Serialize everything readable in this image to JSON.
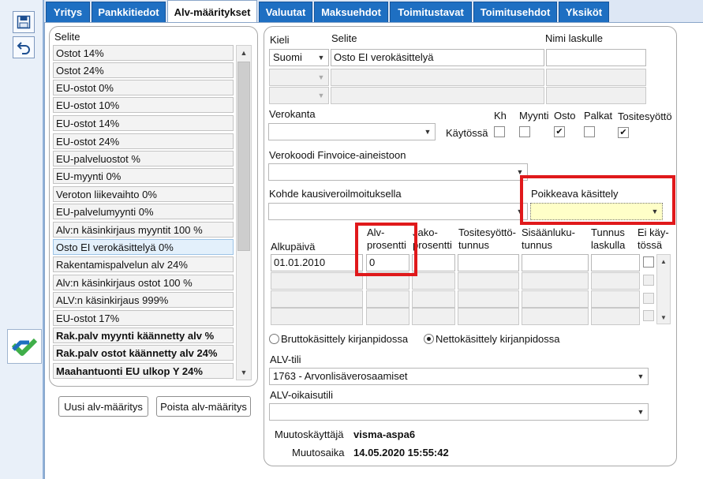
{
  "tabs": [
    {
      "label": "Yritys"
    },
    {
      "label": "Pankkitiedot"
    },
    {
      "label": "Alv-määritykset"
    },
    {
      "label": "Valuutat"
    },
    {
      "label": "Maksuehdot"
    },
    {
      "label": "Toimitustavat"
    },
    {
      "label": "Toimitusehdot"
    },
    {
      "label": "Yksiköt"
    }
  ],
  "active_tab": "Alv-määritykset",
  "toolbar": {
    "save_icon": "save-icon",
    "undo_icon": "undo-icon",
    "logo": "visma-logo"
  },
  "list": {
    "header": "Selite",
    "items": [
      {
        "label": "Ostot 14%"
      },
      {
        "label": "Ostot 24%"
      },
      {
        "label": "EU-ostot 0%"
      },
      {
        "label": "EU-ostot 10%"
      },
      {
        "label": "EU-ostot 14%"
      },
      {
        "label": "EU-ostot 24%"
      },
      {
        "label": "EU-palveluostot %"
      },
      {
        "label": "EU-myynti 0%"
      },
      {
        "label": "Veroton liikevaihto 0%"
      },
      {
        "label": "EU-palvelumyynti 0%"
      },
      {
        "label": "Alv:n käsinkirjaus myyntit 100 %"
      },
      {
        "label": "Osto EI verokäsittelyä 0%"
      },
      {
        "label": "Rakentamispalvelun alv 24%"
      },
      {
        "label": "Alv:n käsinkirjaus ostot 100 %"
      },
      {
        "label": "ALV:n käsinkirjaus 999%"
      },
      {
        "label": "EU-ostot 17%"
      },
      {
        "label": "Rak.palv myynti käännetty alv %"
      },
      {
        "label": "Rak.palv ostot käännetty alv 24%"
      },
      {
        "label": "Maahantuonti EU ulkop Y 24%"
      }
    ],
    "selected_index": 11,
    "new_button": "Uusi alv-määritys",
    "delete_button": "Poista alv-määritys"
  },
  "form": {
    "kieli_label": "Kieli",
    "selite_label": "Selite",
    "nimi_label": "Nimi laskulle",
    "kieli_value": "Suomi",
    "selite_value": "Osto EI verokäsittelyä",
    "nimi_value": "",
    "verokanta_label": "Verokanta",
    "kaytossa_label": "Käytössä",
    "flags": [
      {
        "label": "Kh",
        "checked": false
      },
      {
        "label": "Myynti",
        "checked": false
      },
      {
        "label": "Osto",
        "checked": true
      },
      {
        "label": "Palkat",
        "checked": false
      },
      {
        "label": "Tositesyöttö",
        "checked": true
      }
    ],
    "verokoodi_label": "Verokoodi Finvoice-aineistoon",
    "kohde_label": "Kohde kausiveroilmoituksella",
    "poikkeava_label": "Poikkeava käsittely",
    "columns": {
      "alkupaiva": "Alkupäivä",
      "alv_line1": "Alv-",
      "alv_line2": "prosentti",
      "jako_line1": "Jako-",
      "jako_line2": "prosentti",
      "tosite_line1": "Tositesyöttö-",
      "tosite_line2": "tunnus",
      "sisaan_line1": "Sisäänluku-",
      "sisaan_line2": "tunnus",
      "tunnus_line1": "Tunnus",
      "tunnus_line2": "laskulla",
      "eikay_line1": "Ei käy-",
      "eikay_line2": "tössä"
    },
    "rows": [
      {
        "alkupaiva": "01.01.2010",
        "alv": "0",
        "jako": "",
        "tosite": "",
        "sisaan": "",
        "tunnus": ""
      }
    ],
    "brutto_label": "Bruttokäsittely kirjanpidossa",
    "netto_label": "Nettokäsittely kirjanpidossa",
    "selected_processing": "Nettokäsittely kirjanpidossa",
    "alv_tili_label": "ALV-tili",
    "alv_tili_value": "1763 - Arvonlisäverosaamiset",
    "alv_oikaisu_label": "ALV-oikaisutili",
    "alv_oikaisu_value": "",
    "muutoskayttaja_label": "Muutoskäyttäjä",
    "muutoskayttaja_value": "visma-aspa6",
    "muutosaika_label": "Muutosaika",
    "muutosaika_value": "14.05.2020 15:55:42"
  },
  "colors": {
    "tab_blue": "#1e6fc2",
    "highlight_red": "#e0191b",
    "poikkeava_fill": "#ffffc8",
    "visma_green": "#3fae49",
    "visma_blue": "#1d6fc0"
  }
}
